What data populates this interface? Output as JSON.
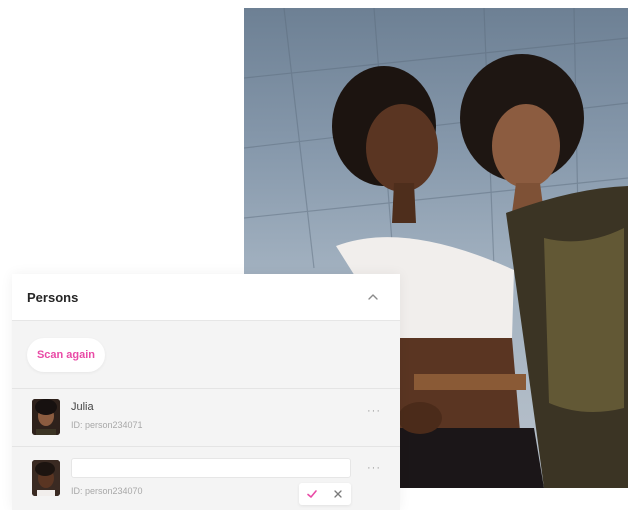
{
  "panel": {
    "title": "Persons",
    "scan_button": "Scan again"
  },
  "persons": [
    {
      "name": "Julia",
      "id_text": "ID: person234071",
      "more": "···"
    },
    {
      "name": "",
      "id_text": "ID: person234070",
      "more": "···",
      "name_input_value": ""
    }
  ],
  "icons": {
    "collapse": "chevron-up-icon",
    "confirm": "check-icon",
    "cancel": "close-icon"
  },
  "colors": {
    "accent": "#e94aa6",
    "panel_bg": "#f4f4f4"
  }
}
